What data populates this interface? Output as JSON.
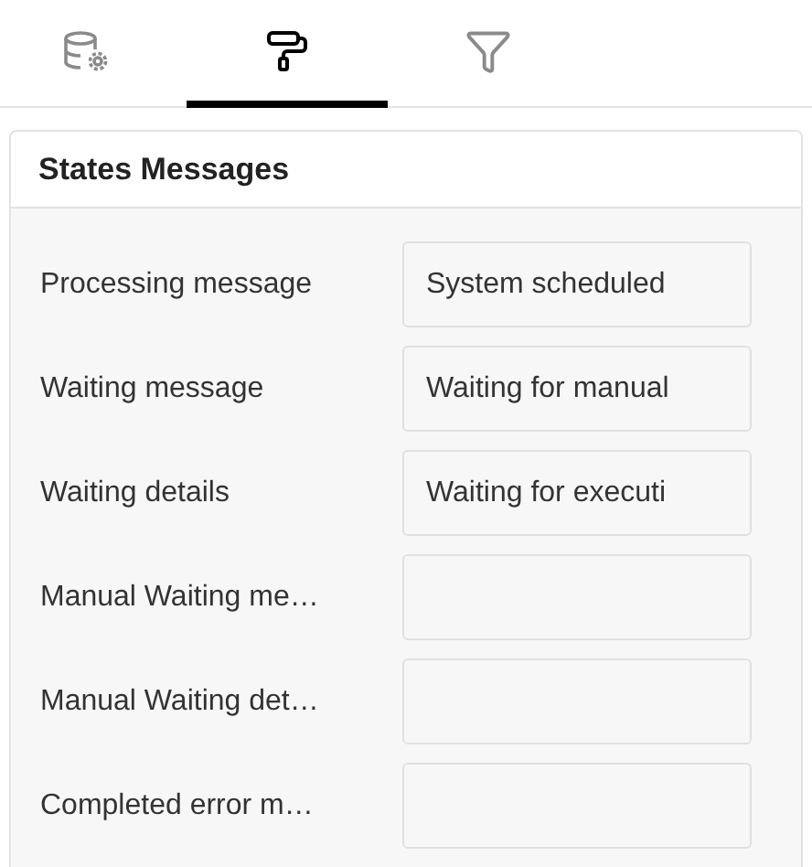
{
  "tabs": [
    {
      "kind": "database",
      "selected": false
    },
    {
      "kind": "style",
      "selected": true
    },
    {
      "kind": "filter",
      "selected": false
    }
  ],
  "panel": {
    "title": "States Messages",
    "fields": [
      {
        "label": "Processing message",
        "value": "System scheduled"
      },
      {
        "label": "Waiting message",
        "value": "Waiting for manual"
      },
      {
        "label": "Waiting details",
        "value": "Waiting for executi"
      },
      {
        "label": "Manual Waiting me…"
      },
      {
        "label": "Manual Waiting det…"
      },
      {
        "label": "Completed error m…"
      }
    ]
  }
}
